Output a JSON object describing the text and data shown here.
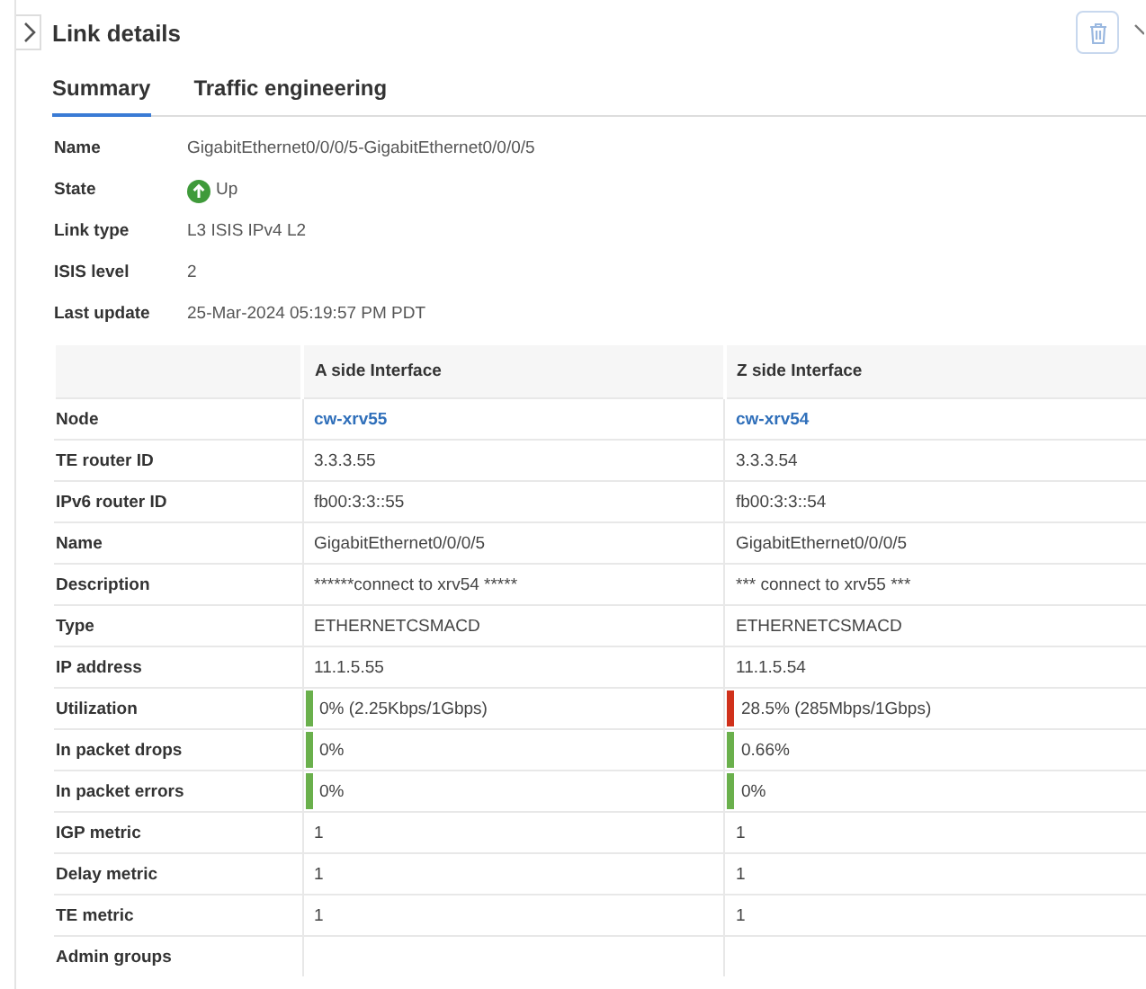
{
  "panel": {
    "title": "Link details"
  },
  "tabs": [
    {
      "label": "Summary",
      "selected": true
    },
    {
      "label": "Traffic engineering",
      "selected": false
    }
  ],
  "summary": [
    {
      "label": "Name",
      "value": "GigabitEthernet0/0/0/5-GigabitEthernet0/0/0/5"
    },
    {
      "label": "State",
      "value": "Up",
      "kind": "status_up"
    },
    {
      "label": "Link type",
      "value": "L3 ISIS IPv4 L2"
    },
    {
      "label": "ISIS level",
      "value": "2"
    },
    {
      "label": "Last update",
      "value": "25-Mar-2024 05:19:57 PM PDT"
    }
  ],
  "table": {
    "columns": [
      "A side Interface",
      "Z side Interface"
    ],
    "rows": [
      {
        "label": "Node",
        "cells": [
          {
            "text": "cw-xrv55",
            "kind": "link"
          },
          {
            "text": "cw-xrv54",
            "kind": "link"
          }
        ]
      },
      {
        "label": "TE router ID",
        "cells": [
          {
            "text": "3.3.3.55",
            "kind": "plain"
          },
          {
            "text": "3.3.3.54",
            "kind": "plain"
          }
        ]
      },
      {
        "label": "IPv6 router ID",
        "cells": [
          {
            "text": "fb00:3:3::55",
            "kind": "plain"
          },
          {
            "text": "fb00:3:3::54",
            "kind": "plain"
          }
        ]
      },
      {
        "label": "Name",
        "cells": [
          {
            "text": "GigabitEthernet0/0/0/5",
            "kind": "plain"
          },
          {
            "text": "GigabitEthernet0/0/0/5",
            "kind": "plain"
          }
        ]
      },
      {
        "label": "Description",
        "cells": [
          {
            "text": "******connect to xrv54 *****",
            "kind": "plain"
          },
          {
            "text": "*** connect to xrv55 ***",
            "kind": "plain"
          }
        ]
      },
      {
        "label": "Type",
        "cells": [
          {
            "text": "ETHERNETCSMACD",
            "kind": "plain"
          },
          {
            "text": "ETHERNETCSMACD",
            "kind": "plain"
          }
        ]
      },
      {
        "label": "IP address",
        "cells": [
          {
            "text": "11.1.5.55",
            "kind": "plain"
          },
          {
            "text": "11.1.5.54",
            "kind": "plain"
          }
        ]
      },
      {
        "label": "Utilization",
        "cells": [
          {
            "text": "0% (2.25Kbps/1Gbps)",
            "kind": "status",
            "color": "#6ab04c"
          },
          {
            "text": "28.5% (285Mbps/1Gbps)",
            "kind": "status",
            "color": "#d0311b"
          }
        ]
      },
      {
        "label": "In packet drops",
        "cells": [
          {
            "text": "0%",
            "kind": "status",
            "color": "#6ab04c"
          },
          {
            "text": "0.66%",
            "kind": "status",
            "color": "#6ab04c"
          }
        ]
      },
      {
        "label": "In packet errors",
        "cells": [
          {
            "text": "0%",
            "kind": "status",
            "color": "#6ab04c"
          },
          {
            "text": "0%",
            "kind": "status",
            "color": "#6ab04c"
          }
        ]
      },
      {
        "label": "IGP metric",
        "cells": [
          {
            "text": "1",
            "kind": "plain"
          },
          {
            "text": "1",
            "kind": "plain"
          }
        ]
      },
      {
        "label": "Delay metric",
        "cells": [
          {
            "text": "1",
            "kind": "plain"
          },
          {
            "text": "1",
            "kind": "plain"
          }
        ]
      },
      {
        "label": "TE metric",
        "cells": [
          {
            "text": "1",
            "kind": "plain"
          },
          {
            "text": "1",
            "kind": "plain"
          }
        ]
      },
      {
        "label": "Admin groups",
        "cells": []
      }
    ]
  }
}
